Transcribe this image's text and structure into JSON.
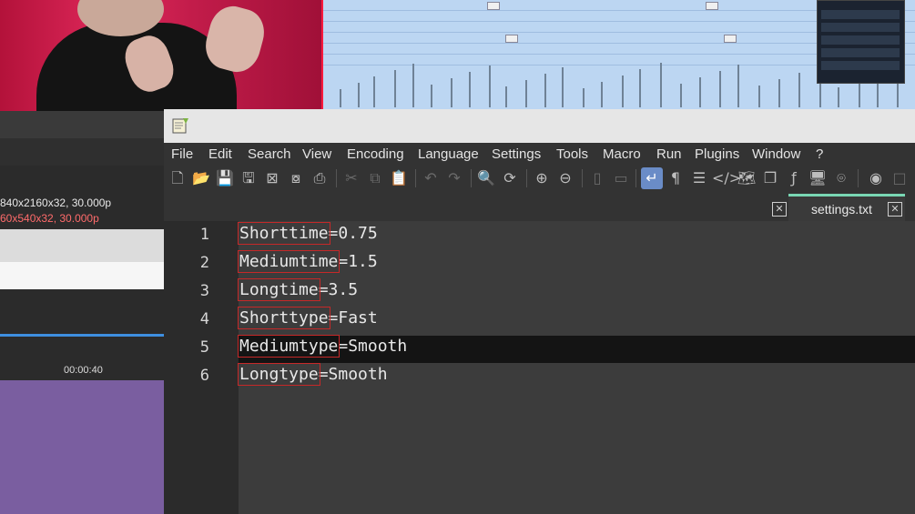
{
  "notepad": {
    "menu": [
      "File",
      "Edit",
      "Search",
      "View",
      "Encoding",
      "Language",
      "Settings",
      "Tools",
      "Macro",
      "Run",
      "Plugins",
      "Window",
      "?"
    ],
    "toolbar_icons": [
      "new-file-icon",
      "open-file-icon",
      "save-icon",
      "save-all-icon",
      "close-icon",
      "close-all-icon",
      "print-icon",
      "cut-icon",
      "copy-icon",
      "paste-icon",
      "undo-icon",
      "redo-icon",
      "find-icon",
      "replace-icon",
      "zoom-in-icon",
      "zoom-out-icon",
      "sync-v-icon",
      "sync-h-icon",
      "word-wrap-icon",
      "show-all-chars-icon",
      "indent-guide-icon",
      "xml-tag-icon",
      "document-map-icon",
      "clipboard-history-icon",
      "function-list-icon",
      "monitoring-icon",
      "screenshot-icon",
      "record-macro-icon",
      "stop-icon"
    ],
    "tab": {
      "label": "settings.txt",
      "close": "✕"
    },
    "lines": [
      {
        "num": "1",
        "key": "Shorttime",
        "value": "=0.75"
      },
      {
        "num": "2",
        "key": "Mediumtime",
        "value": "=1.5"
      },
      {
        "num": "3",
        "key": "Longtime",
        "value": "=3.5"
      },
      {
        "num": "4",
        "key": "Shorttype",
        "value": "=Fast"
      },
      {
        "num": "5",
        "key": "Mediumtype",
        "value": "=Smooth"
      },
      {
        "num": "6",
        "key": "Longtype",
        "value": "=Smooth"
      }
    ],
    "current_line": 5
  },
  "vegas": {
    "resolution_main": "840x2160x32, 30.000p",
    "resolution_preview": "60x540x32, 30.000p",
    "timecode": "00:00:40"
  },
  "colors": {
    "accent_tab": "#79d7b4",
    "highlight_box": "#c62828",
    "webcam_bg": "#e0285b"
  }
}
